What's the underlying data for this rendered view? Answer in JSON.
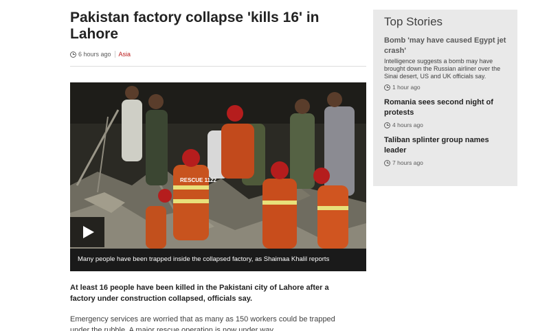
{
  "article": {
    "headline": "Pakistan factory collapse 'kills 16' in Lahore",
    "timestamp": "6 hours ago",
    "section": "Asia",
    "video": {
      "caption": "Many people have been trapped inside the collapsed factory, as Shaimaa Khalil reports",
      "vest_text": "RESCUE 1122"
    },
    "lede": "At least 16 people have been killed in the Pakistani city of Lahore after a factory under construction collapsed, officials say.",
    "paragraph": "Emergency services are worried that as many as 150 workers could be trapped under the rubble. A major rescue operation is now under way."
  },
  "sidebar": {
    "title": "Top Stories",
    "stories": [
      {
        "title": "Bomb 'may have caused Egypt jet crash'",
        "summary": "Intelligence suggests a bomb may have brought down the Russian airliner over the Sinai desert, US and UK officials say.",
        "time": "1 hour ago"
      },
      {
        "title": "Romania sees second night of protests",
        "time": "4 hours ago"
      },
      {
        "title": "Taliban splinter group names leader",
        "time": "7 hours ago"
      }
    ]
  },
  "colors": {
    "section_link": "#bb1919",
    "sidebar_bg": "#e9e9e9",
    "caption_bg": "#1a1a1a"
  },
  "icons": [
    "clock-icon",
    "play-icon"
  ]
}
